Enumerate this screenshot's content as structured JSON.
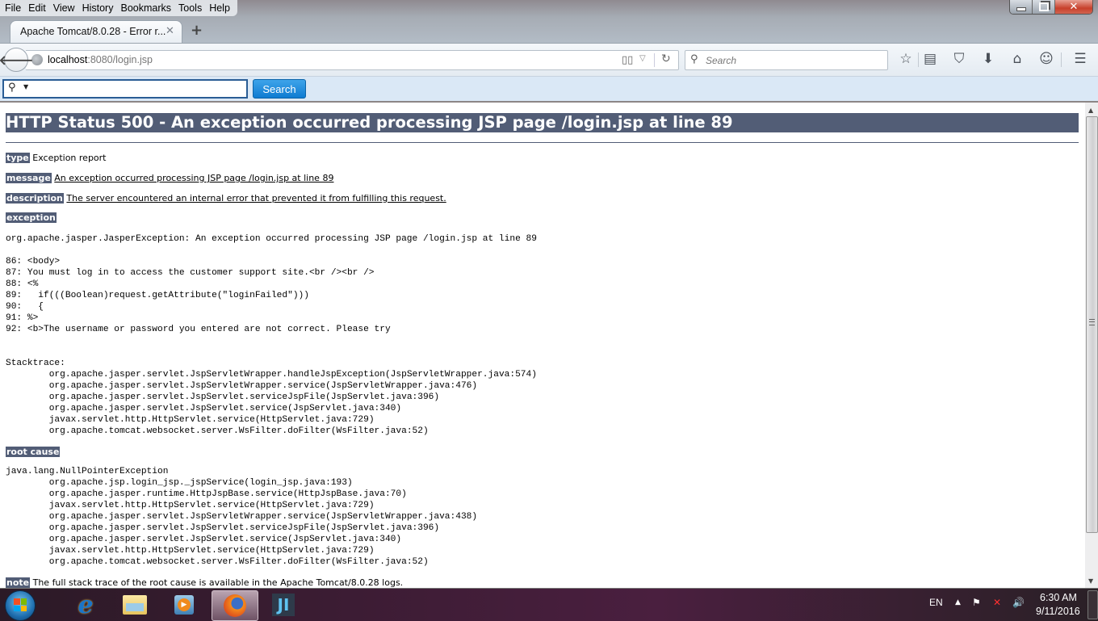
{
  "menubar": {
    "items": [
      {
        "label": "File"
      },
      {
        "label": "Edit"
      },
      {
        "label": "View"
      },
      {
        "label": "History"
      },
      {
        "label": "Bookmarks"
      },
      {
        "label": "Tools"
      },
      {
        "label": "Help"
      }
    ]
  },
  "window_controls": {
    "minimize": "minimize",
    "restore": "restore",
    "close": "✕"
  },
  "tab": {
    "title": "Apache Tomcat/8.0.28 - Error r...",
    "close": "✕",
    "new_tab": "+"
  },
  "navbar": {
    "url_host": "localhost",
    "url_rest": ":8080/login.jsp",
    "search_placeholder": "Search",
    "icons": [
      "star-icon",
      "reading-list-icon",
      "pocket-icon",
      "download-icon",
      "home-icon",
      "chat-icon",
      "menu-icon"
    ]
  },
  "bing_toolbar": {
    "input_value": "",
    "button_label": "Search"
  },
  "page": {
    "title": "HTTP Status 500 - An exception occurred processing JSP page /login.jsp at line 89",
    "type_label": "type",
    "type_value": "Exception report",
    "message_label": "message",
    "message_value": "An exception occurred processing JSP page /login.jsp at line 89",
    "description_label": "description",
    "description_value": "The server encountered an internal error that prevented it from fulfilling this request.",
    "exception_label": "exception",
    "exception_text": "org.apache.jasper.JasperException: An exception occurred processing JSP page /login.jsp at line 89\n\n86: <body>\n87: You must log in to access the customer support site.<br /><br />\n88: <%\n89:   if(((Boolean)request.getAttribute(\"loginFailed\")))\n90:   {\n91: %>\n92: <b>The username or password you entered are not correct. Please try\n\n\nStacktrace:\n\torg.apache.jasper.servlet.JspServletWrapper.handleJspException(JspServletWrapper.java:574)\n\torg.apache.jasper.servlet.JspServletWrapper.service(JspServletWrapper.java:476)\n\torg.apache.jasper.servlet.JspServlet.serviceJspFile(JspServlet.java:396)\n\torg.apache.jasper.servlet.JspServlet.service(JspServlet.java:340)\n\tjavax.servlet.http.HttpServlet.service(HttpServlet.java:729)\n\torg.apache.tomcat.websocket.server.WsFilter.doFilter(WsFilter.java:52)",
    "root_cause_label": "root cause",
    "root_cause_text": "java.lang.NullPointerException\n\torg.apache.jsp.login_jsp._jspService(login_jsp.java:193)\n\torg.apache.jasper.runtime.HttpJspBase.service(HttpJspBase.java:70)\n\tjavax.servlet.http.HttpServlet.service(HttpServlet.java:729)\n\torg.apache.jasper.servlet.JspServletWrapper.service(JspServletWrapper.java:438)\n\torg.apache.jasper.servlet.JspServlet.serviceJspFile(JspServlet.java:396)\n\torg.apache.jasper.servlet.JspServlet.service(JspServlet.java:340)\n\tjavax.servlet.http.HttpServlet.service(HttpServlet.java:729)\n\torg.apache.tomcat.websocket.server.WsFilter.doFilter(WsFilter.java:52)",
    "note_label": "note",
    "note_value": "The full stack trace of the root cause is available in the Apache Tomcat/8.0.28 logs."
  },
  "taskbar": {
    "apps": [
      "Internet Explorer",
      "Windows Explorer",
      "Windows Media Player",
      "Firefox",
      "IntelliJ IDEA"
    ],
    "language": "EN",
    "time": "6:30 AM",
    "date": "9/11/2016"
  },
  "colors": {
    "tomcat_header": "#525d76",
    "bing_button": "#1a86dc",
    "close_button": "#c7402b"
  }
}
